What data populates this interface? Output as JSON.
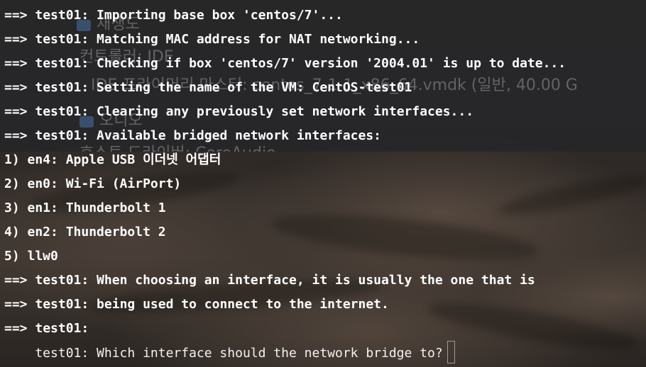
{
  "background_window": {
    "items": [
      {
        "text": "재생도"
      },
      {
        "text": "컨트롤러: IDE"
      },
      {
        "text": "IDE 프라이머리 마스터: centos_7-1-1_x86_64.vmdk (일반, 40.00 G"
      },
      {
        "text": "오디오"
      },
      {
        "text": "호스트 드라이버: CoreAudio"
      }
    ]
  },
  "terminal": {
    "lines": [
      {
        "prefix": "==> ",
        "text": "test01: Importing base box 'centos/7'..."
      },
      {
        "prefix": "==> ",
        "text": "test01: Matching MAC address for NAT networking..."
      },
      {
        "prefix": "==> ",
        "text": "test01: Checking if box 'centos/7' version '2004.01' is up to date..."
      },
      {
        "prefix": "==> ",
        "text": "test01: Setting the name of the VM: CentOS-test01"
      },
      {
        "prefix": "==> ",
        "text": "test01: Clearing any previously set network interfaces..."
      },
      {
        "prefix": "==> ",
        "text": "test01: Available bridged network interfaces:"
      },
      {
        "prefix": "",
        "text": "1) en4: Apple USB 이더넷 어댑터"
      },
      {
        "prefix": "",
        "text": "2) en0: Wi-Fi (AirPort)"
      },
      {
        "prefix": "",
        "text": "3) en1: Thunderbolt 1"
      },
      {
        "prefix": "",
        "text": "4) en2: Thunderbolt 2"
      },
      {
        "prefix": "",
        "text": "5) llw0"
      },
      {
        "prefix": "==> ",
        "text": "test01: When choosing an interface, it is usually the one that is"
      },
      {
        "prefix": "==> ",
        "text": "test01: being used to connect to the internet."
      },
      {
        "prefix": "==> ",
        "text": "test01:"
      }
    ],
    "prompt": "    test01: Which interface should the network bridge to?"
  }
}
